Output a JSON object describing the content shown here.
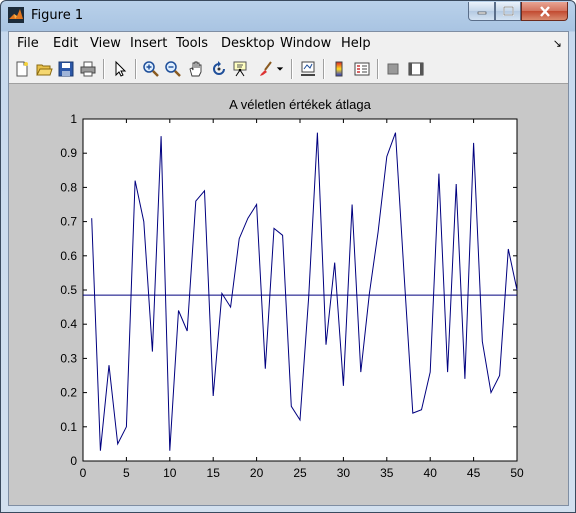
{
  "window": {
    "title": "Figure 1"
  },
  "menu": [
    {
      "label": "File"
    },
    {
      "label": "Edit"
    },
    {
      "label": "View"
    },
    {
      "label": "Insert"
    },
    {
      "label": "Tools"
    },
    {
      "label": "Desktop"
    },
    {
      "label": "Window"
    },
    {
      "label": "Help"
    }
  ],
  "toolbar": {
    "icons": [
      "new-figure-icon",
      "open-file-icon",
      "save-icon",
      "print-icon",
      "edit-plot-arrow-icon",
      "zoom-in-icon",
      "zoom-out-icon",
      "pan-hand-icon",
      "rotate-3d-icon",
      "data-cursor-icon",
      "brush-icon",
      "link-plot-icon",
      "colorbar-icon",
      "legend-icon",
      "hide-plot-tools-icon",
      "show-plot-tools-icon"
    ]
  },
  "colors": {
    "line": "#00007f",
    "axes_bg": "#ffffff",
    "figure_bg": "#c8c8c8"
  },
  "chart_data": {
    "type": "line",
    "title": "A véletlen értékek átlaga",
    "xlabel": "",
    "ylabel": "",
    "xlim": [
      0,
      50
    ],
    "ylim": [
      0,
      1
    ],
    "xticks": [
      0,
      5,
      10,
      15,
      20,
      25,
      30,
      35,
      40,
      45,
      50
    ],
    "yticks": [
      0,
      0.1,
      0.2,
      0.3,
      0.4,
      0.5,
      0.6,
      0.7,
      0.8,
      0.9,
      1
    ],
    "grid": false,
    "series": [
      {
        "type": "line",
        "x": [
          1,
          2,
          3,
          4,
          5,
          6,
          7,
          8,
          9,
          10,
          11,
          12,
          13,
          14,
          15,
          16,
          17,
          18,
          19,
          20,
          21,
          22,
          23,
          24,
          25,
          26,
          27,
          28,
          29,
          30,
          31,
          32,
          33,
          34,
          35,
          36,
          37,
          38,
          39,
          40,
          41,
          42,
          43,
          44,
          45,
          46,
          47,
          48,
          49,
          50
        ],
        "y": [
          0.71,
          0.03,
          0.28,
          0.05,
          0.1,
          0.82,
          0.7,
          0.32,
          0.95,
          0.03,
          0.44,
          0.38,
          0.76,
          0.79,
          0.19,
          0.49,
          0.45,
          0.65,
          0.71,
          0.75,
          0.27,
          0.68,
          0.66,
          0.16,
          0.12,
          0.48,
          0.96,
          0.34,
          0.58,
          0.22,
          0.75,
          0.26,
          0.49,
          0.67,
          0.89,
          0.96,
          0.54,
          0.14,
          0.15,
          0.26,
          0.84,
          0.26,
          0.81,
          0.24,
          0.93,
          0.35,
          0.2,
          0.25,
          0.62,
          0.5
        ]
      },
      {
        "type": "line",
        "x": [
          0,
          50
        ],
        "y": [
          0.485,
          0.485
        ]
      }
    ]
  }
}
